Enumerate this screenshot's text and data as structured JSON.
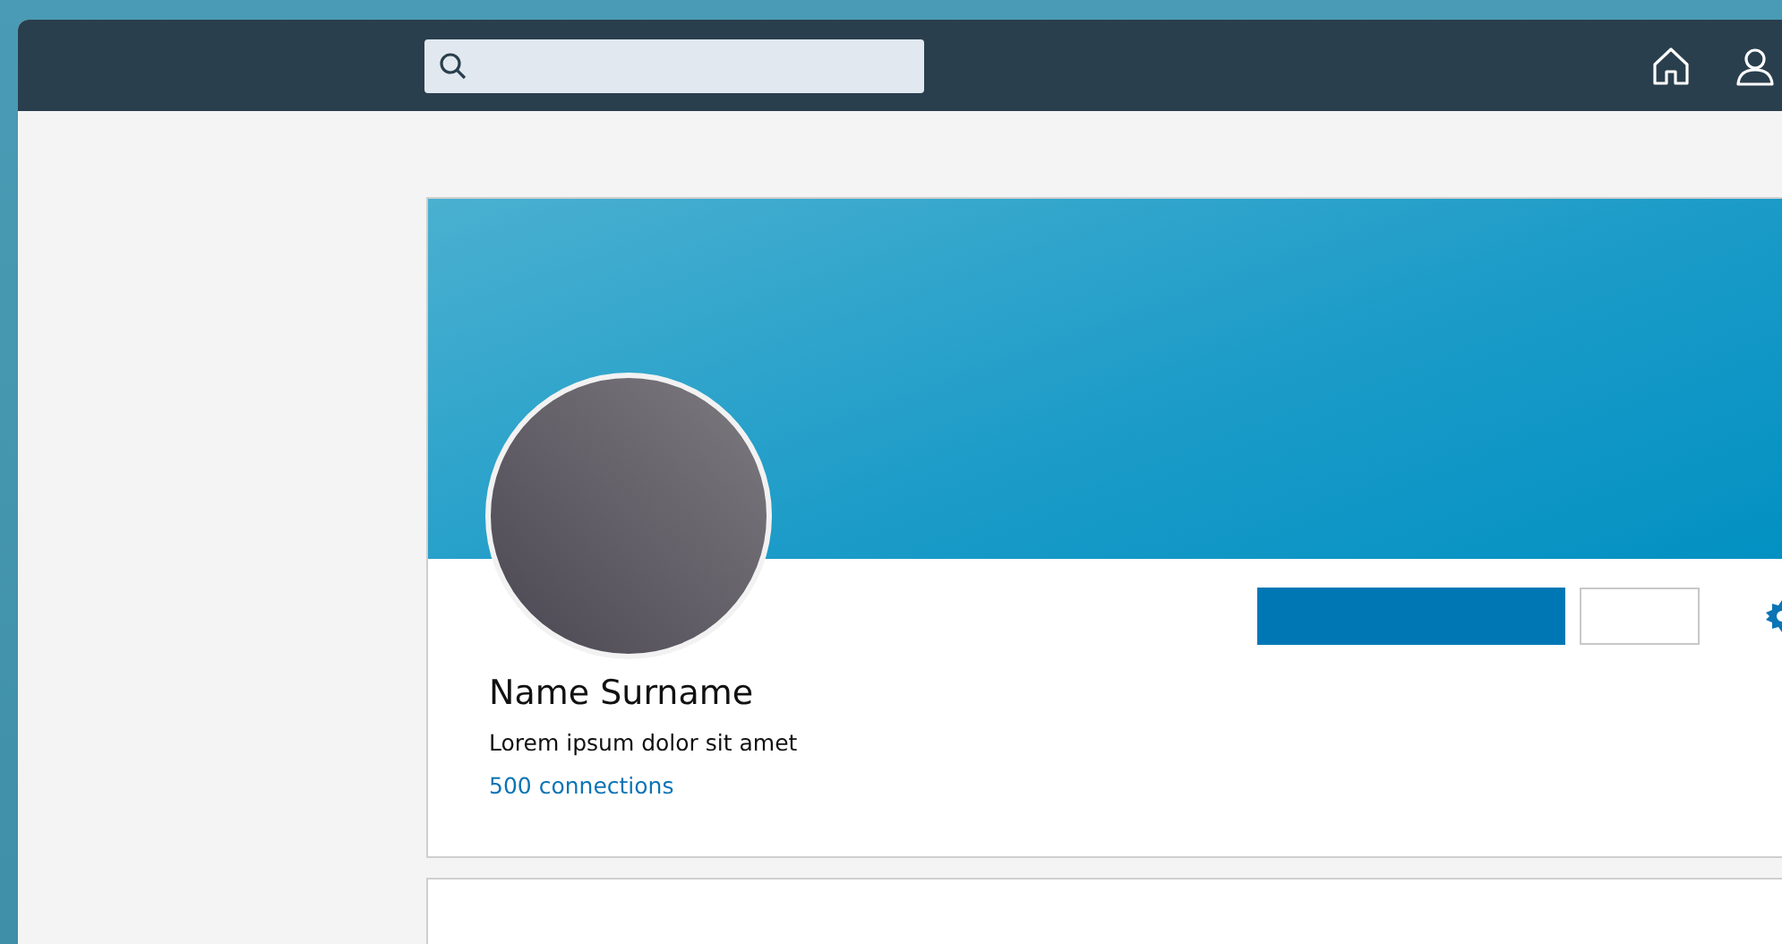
{
  "profile": {
    "name": "Name Surname",
    "headline": "Lorem ipsum dolor sit amet",
    "connections": "500 connections"
  }
}
